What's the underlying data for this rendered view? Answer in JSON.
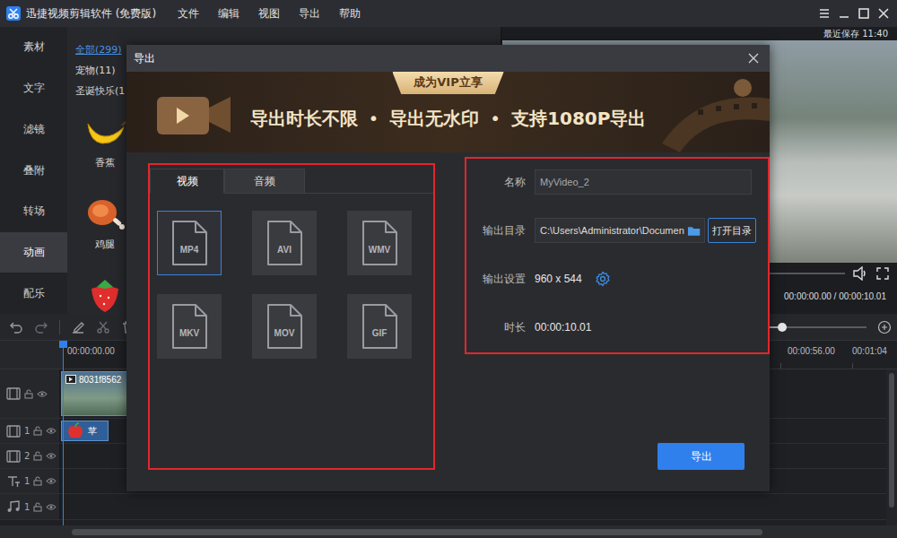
{
  "window": {
    "title": "迅捷视频剪辑软件 (免费版)"
  },
  "menu": [
    {
      "label": "文件"
    },
    {
      "label": "编辑"
    },
    {
      "label": "视图"
    },
    {
      "label": "导出"
    },
    {
      "label": "帮助"
    }
  ],
  "sidebar": {
    "items": [
      {
        "label": "素材",
        "selected": false
      },
      {
        "label": "文字",
        "selected": false
      },
      {
        "label": "滤镜",
        "selected": false
      },
      {
        "label": "叠附",
        "selected": false
      },
      {
        "label": "转场",
        "selected": false
      },
      {
        "label": "动画",
        "selected": true
      },
      {
        "label": "配乐",
        "selected": false
      }
    ]
  },
  "library": {
    "categories": [
      {
        "label": "全部(299)",
        "selected": true
      },
      {
        "label": "宠物(11)",
        "selected": false
      },
      {
        "label": "圣诞快乐(1",
        "selected": false
      }
    ],
    "items": [
      {
        "kind": "banana",
        "label": "香蕉"
      },
      {
        "kind": "drumstick",
        "label": "鸡腿"
      },
      {
        "kind": "strawberry"
      }
    ]
  },
  "preview": {
    "saved": "最近保存 11:40",
    "progress": {
      "level": 0
    },
    "time": "00:00:00.00 / 00:00:10.01"
  },
  "timeline": {
    "zoom": {
      "level": 0.53
    },
    "ruler": [
      "00:00:00.00",
      "00:00:56.00",
      "00:01:04"
    ],
    "tracks": [
      {
        "kind": "video",
        "clip": "8031f8562"
      },
      {
        "kind": "overlay",
        "number": "1",
        "clip": "苹"
      },
      {
        "kind": "overlay",
        "number": "2"
      },
      {
        "kind": "text",
        "number": "1"
      },
      {
        "kind": "music",
        "number": "1"
      }
    ]
  },
  "dialog": {
    "title": "导出",
    "banner": {
      "badge": "成为VIP立享",
      "features": [
        "导出时长不限",
        "导出无水印",
        "支持1080P导出"
      ],
      "separator": "•"
    },
    "tabs": [
      {
        "label": "视频",
        "selected": true
      },
      {
        "label": "音频",
        "selected": false
      }
    ],
    "formats": [
      {
        "label": "MP4",
        "selected": true
      },
      {
        "label": "AVI",
        "selected": false
      },
      {
        "label": "WMV",
        "selected": false
      },
      {
        "label": "MKV",
        "selected": false
      },
      {
        "label": "MOV",
        "selected": false
      },
      {
        "label": "GIF",
        "selected": false
      }
    ],
    "name": {
      "label": "名称",
      "value": "MyVideo_2"
    },
    "directory": {
      "label": "输出目录",
      "value": "C:\\Users\\Administrator\\Documen",
      "button": "打开目录"
    },
    "settings": {
      "label": "输出设置",
      "value": "960 x 544"
    },
    "duration": {
      "label": "时长",
      "value": "00:00:10.01"
    },
    "export_button": "导出"
  }
}
